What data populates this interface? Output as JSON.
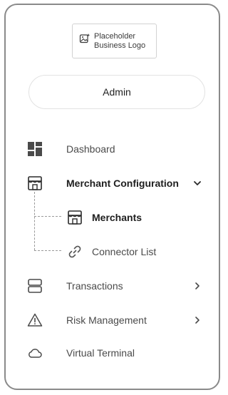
{
  "logo": {
    "line1": "Placeholder",
    "line2": "Business Logo",
    "icon": "image-sparkle-icon"
  },
  "user": {
    "role_label": "Admin"
  },
  "nav": {
    "dashboard": {
      "label": "Dashboard",
      "icon": "dashboard-grid-icon"
    },
    "merchant_configuration": {
      "label": "Merchant Configuration",
      "icon": "storefront-icon",
      "expanded": true,
      "children": [
        {
          "label": "Merchants",
          "icon": "storefront-icon",
          "current": true
        },
        {
          "label": "Connector List",
          "icon": "link-icon",
          "current": false
        }
      ]
    },
    "transactions": {
      "label": "Transactions",
      "icon": "stacked-rows-icon"
    },
    "risk_management": {
      "label": "Risk Management",
      "icon": "warning-triangle-icon"
    },
    "virtual_terminal": {
      "label": "Virtual Terminal",
      "icon": "cloud-icon"
    }
  }
}
